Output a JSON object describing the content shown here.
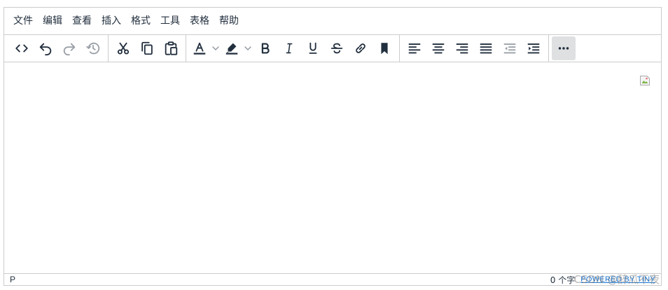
{
  "menubar": {
    "items": [
      "文件",
      "编辑",
      "查看",
      "插入",
      "格式",
      "工具",
      "表格",
      "帮助"
    ]
  },
  "toolbar": {
    "groups": [
      [
        "code-icon",
        "undo-icon",
        "redo-icon",
        "history-icon"
      ],
      [
        "cut-icon",
        "copy-icon",
        "paste-icon"
      ],
      [
        "font-color-icon",
        "highlight-color-icon",
        "bold-icon",
        "italic-icon",
        "underline-icon",
        "strikethrough-icon",
        "link-icon",
        "bookmark-icon"
      ],
      [
        "align-left-icon",
        "align-center-icon",
        "align-right-icon",
        "align-justify-icon",
        "outdent-icon",
        "indent-icon"
      ],
      [
        "more-icon"
      ]
    ],
    "disabled": [
      "redo-icon",
      "history-icon",
      "outdent-icon"
    ],
    "active": [
      "more-icon"
    ],
    "colors": {
      "icon": "#222f3e",
      "active_bg": "#dee0e2",
      "border": "#cccccc"
    }
  },
  "statusbar": {
    "path": "P",
    "wordcount": "0 个字",
    "brand": "POWERED BY TINY"
  },
  "watermark": "CSDN @醉瓜不夜"
}
